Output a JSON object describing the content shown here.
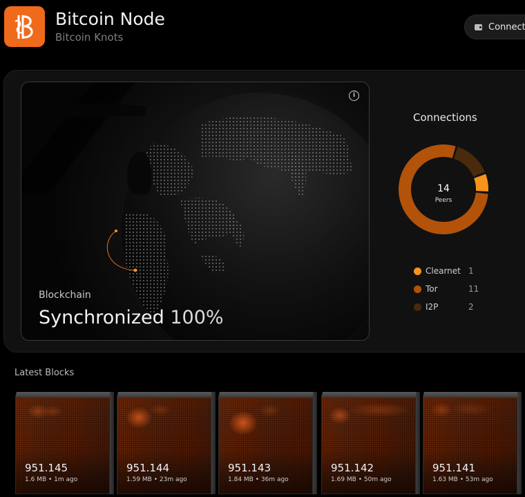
{
  "header": {
    "title": "Bitcoin Node",
    "subtitle": "Bitcoin Knots",
    "connect_label": "Connect"
  },
  "blockchain": {
    "label": "Blockchain",
    "status": "Synchronized",
    "percent": "100%"
  },
  "connections": {
    "title": "Connections",
    "total": "14",
    "total_label": "Peers",
    "items": [
      {
        "name": "Clearnet",
        "value": "1",
        "color": "#f7931a"
      },
      {
        "name": "Tor",
        "value": "11",
        "color": "#b35309"
      },
      {
        "name": "I2P",
        "value": "2",
        "color": "#4a2a0c"
      }
    ]
  },
  "latest_blocks": {
    "title": "Latest Blocks",
    "blocks": [
      {
        "height": "951.145",
        "meta": "1.6 MB • 1m ago"
      },
      {
        "height": "951.144",
        "meta": "1.59 MB • 23m ago"
      },
      {
        "height": "951.143",
        "meta": "1.84 MB • 36m ago"
      },
      {
        "height": "951.142",
        "meta": "1.69 MB • 50m ago"
      },
      {
        "height": "951.141",
        "meta": "1.63 MB • 53m ago"
      }
    ]
  },
  "icons": {
    "logo": "bitcoin-knots-logo",
    "connect": "wallet-icon",
    "info": "info-icon"
  },
  "colors": {
    "accent": "#f06a1b",
    "tor": "#b35309",
    "i2p": "#4a2a0c"
  }
}
